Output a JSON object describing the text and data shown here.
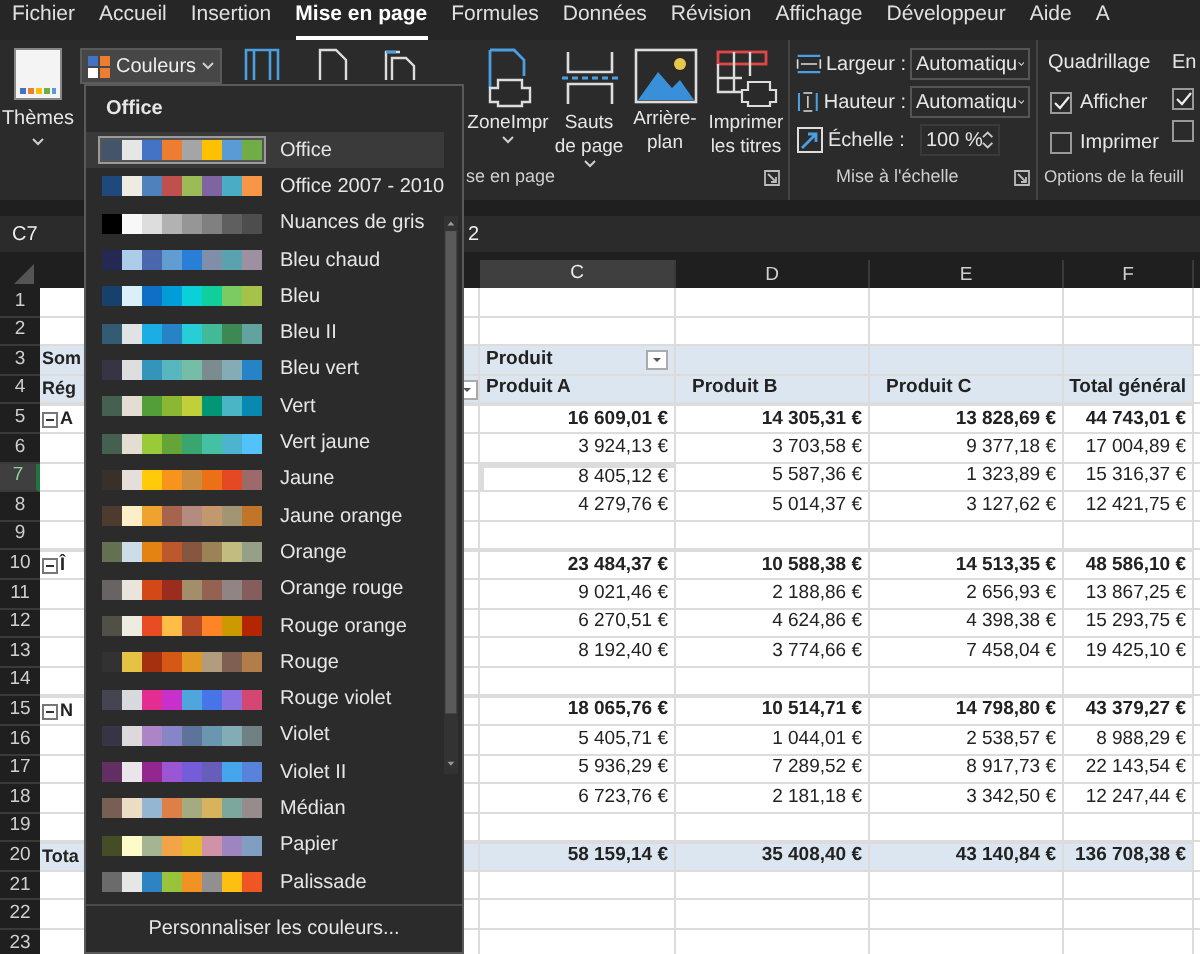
{
  "ribbon_tabs": [
    {
      "label": "Fichier",
      "selected": false
    },
    {
      "label": "Accueil",
      "selected": false
    },
    {
      "label": "Insertion",
      "selected": false
    },
    {
      "label": "Mise en page",
      "selected": true
    },
    {
      "label": "Formules",
      "selected": false
    },
    {
      "label": "Données",
      "selected": false
    },
    {
      "label": "Révision",
      "selected": false
    },
    {
      "label": "Affichage",
      "selected": false
    },
    {
      "label": "Développeur",
      "selected": false
    },
    {
      "label": "Aide",
      "selected": false
    },
    {
      "label": "A",
      "selected": false
    }
  ],
  "ribbon": {
    "themes_button": {
      "label": "Thèmes"
    },
    "colors_button": {
      "label": "Couleurs"
    },
    "page_setup": {
      "buttons": [
        {
          "label": "ZoneImpr",
          "kind": "print-area",
          "caret": true
        },
        {
          "label": "Sauts de page",
          "kind": "breaks",
          "caret": true
        },
        {
          "label": "Arrière-plan",
          "kind": "background",
          "caret": false
        },
        {
          "label": "Imprimer les titres",
          "kind": "titles",
          "caret": false
        }
      ],
      "group_label": "se en page"
    },
    "scale": {
      "fields": [
        {
          "label": "Largeur :",
          "value": "Automatiqu",
          "kind": "dropdown"
        },
        {
          "label": "Hauteur :",
          "value": "Automatiqu",
          "kind": "dropdown"
        },
        {
          "label": "Échelle :",
          "value": "100 %",
          "kind": "spinner"
        }
      ],
      "group_label": "Mise à l'échelle"
    },
    "sheet_options": {
      "heading": "Quadrillage",
      "options": [
        {
          "label": "Afficher",
          "checked": true
        },
        {
          "label": "Imprimer",
          "checked": false
        }
      ],
      "group_label": "Options de la feuill"
    },
    "next_group": {
      "heading": "En",
      "options": [
        {
          "checked": true
        },
        {
          "checked": false
        }
      ]
    }
  },
  "formula_bar": {
    "name_box": "C7",
    "value": "2"
  },
  "colors_menu": {
    "heading": "Office",
    "themes": [
      {
        "name": "Office",
        "selected": true,
        "swatches": [
          {
            "color": "#44546a"
          },
          {
            "color": "#e7e6e6"
          },
          {
            "color": "#4472c4"
          },
          {
            "color": "#ed7d31"
          },
          {
            "color": "#a5a5a5"
          },
          {
            "color": "#ffc000"
          },
          {
            "color": "#5b9bd5"
          },
          {
            "color": "#70ad47"
          }
        ]
      },
      {
        "name": "Office 2007 - 2010",
        "selected": false,
        "swatches": [
          {
            "color": "#1f497d"
          },
          {
            "color": "#eeece1"
          },
          {
            "color": "#4f81bd"
          },
          {
            "color": "#c0504d"
          },
          {
            "color": "#9bbb59"
          },
          {
            "color": "#8064a2"
          },
          {
            "color": "#4bacc6"
          },
          {
            "color": "#f79646"
          }
        ]
      },
      {
        "name": "Nuances de gris",
        "selected": false,
        "swatches": [
          {
            "color": "#000000"
          },
          {
            "color": "#f8f8f8"
          },
          {
            "color": "#dddddd"
          },
          {
            "color": "#b2b2b2"
          },
          {
            "color": "#969696"
          },
          {
            "color": "#808080"
          },
          {
            "color": "#5f5f5f"
          },
          {
            "color": "#4d4d4d"
          }
        ]
      },
      {
        "name": "Bleu chaud",
        "selected": false,
        "swatches": [
          {
            "color": "#242852"
          },
          {
            "color": "#acccea"
          },
          {
            "color": "#4a66ac"
          },
          {
            "color": "#629dd1"
          },
          {
            "color": "#297fd5"
          },
          {
            "color": "#7f8fa9"
          },
          {
            "color": "#5aa2ae"
          },
          {
            "color": "#9d90a0"
          }
        ]
      },
      {
        "name": "Bleu",
        "selected": false,
        "swatches": [
          {
            "color": "#17406d"
          },
          {
            "color": "#dbeff9"
          },
          {
            "color": "#0f6fc6"
          },
          {
            "color": "#009dd9"
          },
          {
            "color": "#0bd0d9"
          },
          {
            "color": "#10cf9b"
          },
          {
            "color": "#7cca62"
          },
          {
            "color": "#a5c249"
          }
        ]
      },
      {
        "name": "Bleu II",
        "selected": false,
        "swatches": [
          {
            "color": "#335b74"
          },
          {
            "color": "#dfe3e5"
          },
          {
            "color": "#1cade4"
          },
          {
            "color": "#2683c6"
          },
          {
            "color": "#27ced7"
          },
          {
            "color": "#42ba97"
          },
          {
            "color": "#3e8853"
          },
          {
            "color": "#62a39f"
          }
        ]
      },
      {
        "name": "Bleu vert",
        "selected": false,
        "swatches": [
          {
            "color": "#373545"
          },
          {
            "color": "#dedede"
          },
          {
            "color": "#3494ba"
          },
          {
            "color": "#58b6c0"
          },
          {
            "color": "#75bda7"
          },
          {
            "color": "#7a8c8e"
          },
          {
            "color": "#84acb6"
          },
          {
            "color": "#2683c6"
          }
        ]
      },
      {
        "name": "Vert",
        "selected": false,
        "swatches": [
          {
            "color": "#455f51"
          },
          {
            "color": "#e3ded1"
          },
          {
            "color": "#549e39"
          },
          {
            "color": "#8ab833"
          },
          {
            "color": "#c0cf3a"
          },
          {
            "color": "#029676"
          },
          {
            "color": "#4ab5c4"
          },
          {
            "color": "#0989b1"
          }
        ]
      },
      {
        "name": "Vert jaune",
        "selected": false,
        "swatches": [
          {
            "color": "#455f51"
          },
          {
            "color": "#e3ded1"
          },
          {
            "color": "#99cb38"
          },
          {
            "color": "#63a537"
          },
          {
            "color": "#37a76f"
          },
          {
            "color": "#44c1a3"
          },
          {
            "color": "#4eb3cf"
          },
          {
            "color": "#51c3f9"
          }
        ]
      },
      {
        "name": "Jaune",
        "selected": false,
        "swatches": [
          {
            "color": "#39302a"
          },
          {
            "color": "#e5dedb"
          },
          {
            "color": "#ffca08"
          },
          {
            "color": "#f8931d"
          },
          {
            "color": "#ce8d3e"
          },
          {
            "color": "#ec7016"
          },
          {
            "color": "#e64823"
          },
          {
            "color": "#9c6a6a"
          }
        ]
      },
      {
        "name": "Jaune orange",
        "selected": false,
        "swatches": [
          {
            "color": "#4e3b30"
          },
          {
            "color": "#fbeec9"
          },
          {
            "color": "#f0a22e"
          },
          {
            "color": "#a5644e"
          },
          {
            "color": "#b58b80"
          },
          {
            "color": "#c3986d"
          },
          {
            "color": "#a19574"
          },
          {
            "color": "#c17529"
          }
        ]
      },
      {
        "name": "Orange",
        "selected": false,
        "swatches": [
          {
            "color": "#637052"
          },
          {
            "color": "#ccddea"
          },
          {
            "color": "#e48312"
          },
          {
            "color": "#bd582c"
          },
          {
            "color": "#865640"
          },
          {
            "color": "#9b8357"
          },
          {
            "color": "#c2bc80"
          },
          {
            "color": "#94a088"
          }
        ]
      },
      {
        "name": "Orange rouge",
        "selected": false,
        "swatches": [
          {
            "color": "#696464"
          },
          {
            "color": "#e9e5dc"
          },
          {
            "color": "#d34817"
          },
          {
            "color": "#9b2d1f"
          },
          {
            "color": "#a28e6a"
          },
          {
            "color": "#956251"
          },
          {
            "color": "#918485"
          },
          {
            "color": "#855d5d"
          }
        ]
      },
      {
        "name": "Rouge orange",
        "selected": false,
        "swatches": [
          {
            "color": "#505046"
          },
          {
            "color": "#eeece1"
          },
          {
            "color": "#e84c22"
          },
          {
            "color": "#ffbd47"
          },
          {
            "color": "#b64926"
          },
          {
            "color": "#ff8427"
          },
          {
            "color": "#cc9900"
          },
          {
            "color": "#b22600"
          }
        ]
      },
      {
        "name": "Rouge",
        "selected": false,
        "swatches": [
          {
            "color": "#323232"
          },
          {
            "color": "#e5c243"
          },
          {
            "color": "#a5300f"
          },
          {
            "color": "#d55816"
          },
          {
            "color": "#e19825"
          },
          {
            "color": "#b19c7d"
          },
          {
            "color": "#7f5f52"
          },
          {
            "color": "#b27d49"
          }
        ]
      },
      {
        "name": "Rouge violet",
        "selected": false,
        "swatches": [
          {
            "color": "#454551"
          },
          {
            "color": "#d8d9dc"
          },
          {
            "color": "#e32d91"
          },
          {
            "color": "#c830cc"
          },
          {
            "color": "#4ea6dc"
          },
          {
            "color": "#4775e7"
          },
          {
            "color": "#8971e1"
          },
          {
            "color": "#d54773"
          }
        ]
      },
      {
        "name": "Violet",
        "selected": false,
        "swatches": [
          {
            "color": "#373545"
          },
          {
            "color": "#dcd8dc"
          },
          {
            "color": "#ad84c6"
          },
          {
            "color": "#8784c7"
          },
          {
            "color": "#5d739a"
          },
          {
            "color": "#6997af"
          },
          {
            "color": "#84acb6"
          },
          {
            "color": "#6f8183"
          }
        ]
      },
      {
        "name": "Violet II",
        "selected": false,
        "swatches": [
          {
            "color": "#632e62"
          },
          {
            "color": "#eae5eb"
          },
          {
            "color": "#92278f"
          },
          {
            "color": "#9b57d3"
          },
          {
            "color": "#755dd9"
          },
          {
            "color": "#665eb8"
          },
          {
            "color": "#45a5ed"
          },
          {
            "color": "#5982db"
          }
        ]
      },
      {
        "name": "Médian",
        "selected": false,
        "swatches": [
          {
            "color": "#775f55"
          },
          {
            "color": "#ebddc3"
          },
          {
            "color": "#94b6d2"
          },
          {
            "color": "#dd8047"
          },
          {
            "color": "#a5ab81"
          },
          {
            "color": "#d8b25c"
          },
          {
            "color": "#7ba79d"
          },
          {
            "color": "#968c8c"
          }
        ]
      },
      {
        "name": "Papier",
        "selected": false,
        "swatches": [
          {
            "color": "#444d26"
          },
          {
            "color": "#fefac9"
          },
          {
            "color": "#a5b592"
          },
          {
            "color": "#f3a447"
          },
          {
            "color": "#e7bc29"
          },
          {
            "color": "#d092a7"
          },
          {
            "color": "#9c85c0"
          },
          {
            "color": "#809ec2"
          }
        ]
      },
      {
        "name": "Palissade",
        "selected": false,
        "swatches": [
          {
            "color": "#6b6b6b"
          },
          {
            "color": "#e6e6e6"
          },
          {
            "color": "#2e83c3"
          },
          {
            "color": "#99c33a"
          },
          {
            "color": "#f39224"
          },
          {
            "color": "#909090"
          },
          {
            "color": "#fdc010"
          },
          {
            "color": "#ef5623"
          }
        ]
      }
    ],
    "footer": "Personnaliser les couleurs..."
  },
  "sheet": {
    "columns": [
      {
        "label": "C",
        "selected": true
      },
      {
        "label": "D",
        "selected": false
      },
      {
        "label": "E",
        "selected": false
      },
      {
        "label": "F",
        "selected": false
      }
    ],
    "rows": [
      {
        "label": "1",
        "selected": false,
        "kind": "blank"
      },
      {
        "label": "2",
        "selected": false,
        "kind": "blank"
      },
      {
        "label": "3",
        "selected": false,
        "kind": "field_header",
        "first": "Som",
        "field": "Produit"
      },
      {
        "label": "4",
        "selected": false,
        "kind": "column_header",
        "first": "Rég",
        "cells": [
          "Produit A",
          "Produit B",
          "Produit C",
          "Total général"
        ]
      },
      {
        "label": "5",
        "selected": false,
        "kind": "group",
        "first": "A",
        "expanded": true,
        "cells": [
          "16 609,01 €",
          "14 305,31 €",
          "13 828,69 €",
          "44 743,01 €"
        ]
      },
      {
        "label": "6",
        "selected": false,
        "kind": "detail",
        "cells": [
          "3 924,13 €",
          "3 703,58 €",
          "9 377,18 €",
          "17 004,89 €"
        ]
      },
      {
        "label": "7",
        "selected": true,
        "kind": "detail",
        "cells": [
          "8 405,12 €",
          "5 587,36 €",
          "1 323,89 €",
          "15 316,37 €"
        ]
      },
      {
        "label": "8",
        "selected": false,
        "kind": "detail",
        "cells": [
          "4 279,76 €",
          "5 014,37 €",
          "3 127,62 €",
          "12 421,75 €"
        ]
      },
      {
        "label": "9",
        "selected": false,
        "kind": "blank"
      },
      {
        "label": "10",
        "selected": false,
        "kind": "group",
        "first": "Î",
        "expanded": true,
        "cells": [
          "23 484,37 €",
          "10 588,38 €",
          "14 513,35 €",
          "48 586,10 €"
        ]
      },
      {
        "label": "11",
        "selected": false,
        "kind": "detail",
        "cells": [
          "9 021,46 €",
          "2 188,86 €",
          "2 656,93 €",
          "13 867,25 €"
        ]
      },
      {
        "label": "12",
        "selected": false,
        "kind": "detail",
        "cells": [
          "6 270,51 €",
          "4 624,86 €",
          "4 398,38 €",
          "15 293,75 €"
        ]
      },
      {
        "label": "13",
        "selected": false,
        "kind": "detail",
        "cells": [
          "8 192,40 €",
          "3 774,66 €",
          "7 458,04 €",
          "19 425,10 €"
        ]
      },
      {
        "label": "14",
        "selected": false,
        "kind": "blank"
      },
      {
        "label": "15",
        "selected": false,
        "kind": "group",
        "first": "N",
        "expanded": true,
        "cells": [
          "18 065,76 €",
          "10 514,71 €",
          "14 798,80 €",
          "43 379,27 €"
        ]
      },
      {
        "label": "16",
        "selected": false,
        "kind": "detail",
        "cells": [
          "5 405,71 €",
          "1 044,01 €",
          "2 538,57 €",
          "8 988,29 €"
        ]
      },
      {
        "label": "17",
        "selected": false,
        "kind": "detail",
        "cells": [
          "5 936,29 €",
          "7 289,52 €",
          "8 917,73 €",
          "22 143,54 €"
        ]
      },
      {
        "label": "18",
        "selected": false,
        "kind": "detail",
        "cells": [
          "6 723,76 €",
          "2 181,18 €",
          "3 342,50 €",
          "12 247,44 €"
        ]
      },
      {
        "label": "19",
        "selected": false,
        "kind": "blank"
      },
      {
        "label": "20",
        "selected": false,
        "kind": "grand_total",
        "first": "Tota",
        "cells": [
          "58 159,14 €",
          "35 408,40 €",
          "43 140,84 €",
          "136 708,38 €"
        ]
      },
      {
        "label": "21",
        "selected": false,
        "kind": "blank"
      },
      {
        "label": "22",
        "selected": false,
        "kind": "blank"
      },
      {
        "label": "23",
        "selected": false,
        "kind": "blank"
      }
    ]
  }
}
